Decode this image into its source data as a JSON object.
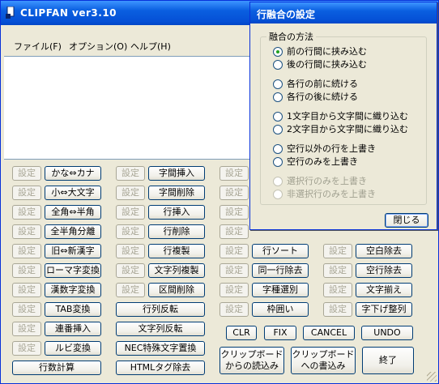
{
  "window": {
    "title": "CLIPFAN ver3.10"
  },
  "menu": [
    {
      "label": "ファイル(F)"
    },
    {
      "label": "オプション(O)"
    },
    {
      "label": "ヘルプ(H)"
    }
  ],
  "text_content": "",
  "buttons": {
    "set_label": "設定",
    "col1": [
      "かな⇔カナ",
      "小⇔大文字",
      "全角⇔半角",
      "全半角分離",
      "旧⇔新漢字",
      "ローマ字変換",
      "漢数字変換",
      "TAB変換",
      "連番挿入",
      "ルビ変換",
      "行数計算"
    ],
    "col2": [
      "字間挿入",
      "字間削除",
      "行挿入",
      "行削除",
      "行複製",
      "文字列複製",
      "区間削除",
      "行列反転",
      "文字列反転",
      "NEC特殊文字置換",
      "HTMLタグ除去"
    ],
    "col3": [
      "",
      "",
      "",
      "",
      "行ソート",
      "同一行除去",
      "字種選別",
      "枠囲い"
    ],
    "col4": [
      "空白除去",
      "空行除去",
      "文字揃え",
      "字下げ整列"
    ],
    "clr": "CLR",
    "fix": "FIX",
    "cancel": "CANCEL",
    "undo": "UNDO",
    "read_clip": [
      "クリップボード",
      "からの読込み"
    ],
    "write_clip": [
      "クリップボード",
      "への書込み"
    ],
    "end": "終了"
  },
  "dialog": {
    "title": "行融合の設定",
    "group_label": "融合の方法",
    "options": [
      {
        "label": "前の行間に挟み込む",
        "selected": true,
        "enabled": true
      },
      {
        "label": "後の行間に挟み込む",
        "selected": false,
        "enabled": true
      },
      {
        "label": "各行の前に続ける",
        "selected": false,
        "enabled": true
      },
      {
        "label": "各行の後に続ける",
        "selected": false,
        "enabled": true
      },
      {
        "label": "1文字目から文字間に織り込む",
        "selected": false,
        "enabled": true
      },
      {
        "label": "2文字目から文字間に織り込む",
        "selected": false,
        "enabled": true
      },
      {
        "label": "空行以外の行を上書き",
        "selected": false,
        "enabled": true
      },
      {
        "label": "空行のみを上書き",
        "selected": false,
        "enabled": true
      },
      {
        "label": "選択行のみを上書き",
        "selected": false,
        "enabled": false
      },
      {
        "label": "非選択行のみを上書き",
        "selected": false,
        "enabled": false
      }
    ],
    "close_label": "閉じる"
  }
}
